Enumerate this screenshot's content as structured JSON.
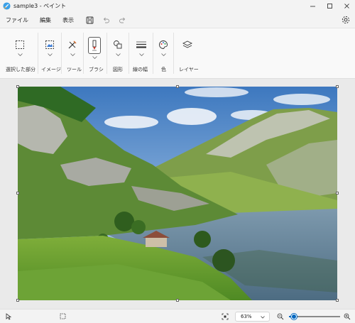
{
  "window": {
    "title": "sample3 - ペイント"
  },
  "menu": {
    "items": [
      "ファイル",
      "編集",
      "表示"
    ]
  },
  "ribbon": {
    "groups": [
      {
        "label": "選択した部分",
        "icon": "selection-icon"
      },
      {
        "label": "イメージ",
        "icon": "image-icon"
      },
      {
        "label": "ツール",
        "icon": "tools-icon"
      },
      {
        "label": "ブラシ",
        "icon": "brush-icon"
      },
      {
        "label": "図形",
        "icon": "shapes-icon"
      },
      {
        "label": "線の幅",
        "icon": "line-width-icon"
      },
      {
        "label": "色",
        "icon": "palette-icon"
      },
      {
        "label": "レイヤー",
        "icon": "layers-icon"
      }
    ]
  },
  "status": {
    "zoom": "63%",
    "zoom_fraction": 0.1
  },
  "colors": {
    "accent": "#0067c0"
  }
}
